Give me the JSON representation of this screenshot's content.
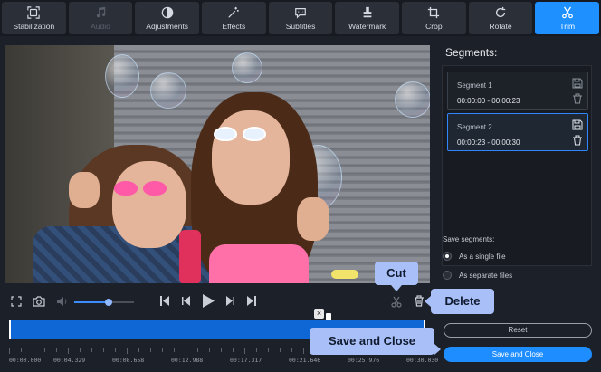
{
  "tabs": [
    {
      "label": "Stabilization",
      "icon": "stabilization-icon",
      "state": "normal"
    },
    {
      "label": "Audio",
      "icon": "music-note-icon",
      "state": "disabled"
    },
    {
      "label": "Adjustments",
      "icon": "contrast-icon",
      "state": "normal"
    },
    {
      "label": "Effects",
      "icon": "magic-wand-icon",
      "state": "normal"
    },
    {
      "label": "Subtitles",
      "icon": "speech-bubble-icon",
      "state": "normal"
    },
    {
      "label": "Watermark",
      "icon": "stamp-icon",
      "state": "normal"
    },
    {
      "label": "Crop",
      "icon": "crop-icon",
      "state": "normal"
    },
    {
      "label": "Rotate",
      "icon": "rotate-icon",
      "state": "normal"
    },
    {
      "label": "Trim",
      "icon": "scissors-icon",
      "state": "active"
    }
  ],
  "player": {
    "volume_level": 0.58
  },
  "timeline": {
    "selection_start_fraction": 0.0,
    "selection_end_fraction": 1.0,
    "playhead_fraction": 0.767,
    "ticks": [
      "00:00.000",
      "00:04.329",
      "00:08.658",
      "00:12.988",
      "00:17.317",
      "00:21.646",
      "00:25.976",
      "00:30.030"
    ]
  },
  "panel": {
    "title": "Segments:",
    "segments": [
      {
        "name": "Segment 1",
        "time": "00:00:00 - 00:00:23",
        "active": false
      },
      {
        "name": "Segment 2",
        "time": "00:00:23 - 00:00:30",
        "active": true
      }
    ],
    "save_label": "Save segments:",
    "options": [
      {
        "label": "As a single file",
        "selected": true
      },
      {
        "label": "As separate files",
        "selected": false
      }
    ],
    "reset_label": "Reset",
    "save_close_label": "Save and Close"
  },
  "callouts": {
    "cut": "Cut",
    "delete": "Delete",
    "save_close": "Save and Close"
  },
  "colors": {
    "accent": "#1e8dff",
    "callout": "#a9bff7",
    "background": "#1c2028"
  }
}
